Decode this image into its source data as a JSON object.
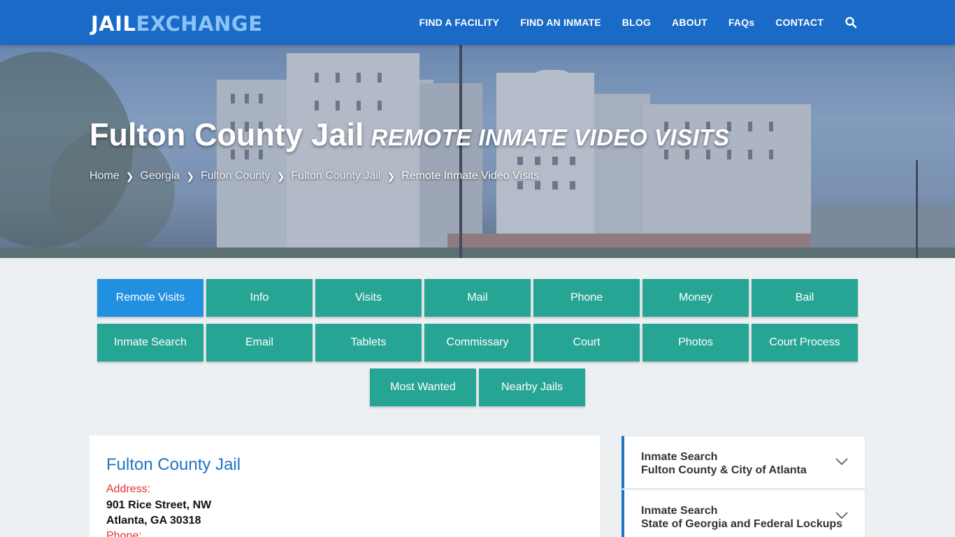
{
  "logo": {
    "part1": "JAIL",
    "part2": "EXCHANGE"
  },
  "nav": {
    "items": [
      "FIND A FACILITY",
      "FIND AN INMATE",
      "BLOG",
      "ABOUT",
      "FAQs",
      "CONTACT"
    ],
    "search_icon": "search-icon"
  },
  "hero": {
    "title": "Fulton County Jail",
    "subtitle": "REMOTE INMATE VIDEO VISITS",
    "breadcrumb": [
      "Home",
      "Georgia",
      "Fulton County",
      "Fulton County Jail",
      "Remote Inmate Video Visits"
    ]
  },
  "tabs": {
    "row1": [
      "Remote Visits",
      "Info",
      "Visits",
      "Mail",
      "Phone",
      "Money",
      "Bail"
    ],
    "row2": [
      "Inmate Search",
      "Email",
      "Tablets",
      "Commissary",
      "Court",
      "Photos",
      "Court Process"
    ],
    "row3": [
      "Most Wanted",
      "Nearby Jails"
    ],
    "active": "Remote Visits"
  },
  "card": {
    "title": "Fulton County Jail",
    "address_label": "Address:",
    "address_line1": "901 Rice Street, NW",
    "address_line2": "Atlanta, GA 30318",
    "phone_label": "Phone:"
  },
  "sidebar": {
    "items": [
      {
        "line1": "Inmate Search",
        "line2": "Fulton County & City of Atlanta"
      },
      {
        "line1": "Inmate Search",
        "line2": "State of Georgia and Federal Lockups"
      }
    ]
  },
  "colors": {
    "header": "#1a6ac7",
    "tab": "#27a594",
    "tab_active": "#2290e0",
    "accent_red": "#e2332f",
    "title_blue": "#1f74c4"
  }
}
